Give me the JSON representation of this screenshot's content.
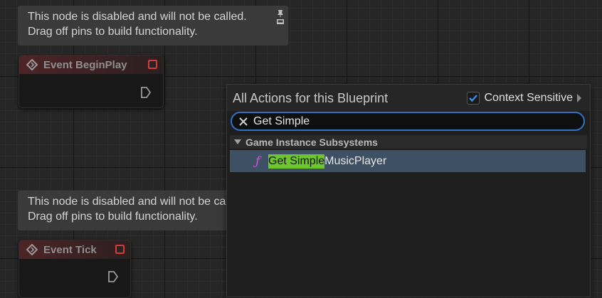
{
  "comments": {
    "top": {
      "line1": "This node is disabled and will not be called.",
      "line2": "Drag off pins to build functionality."
    },
    "bottom": {
      "line1": "This node is disabled and will not be called.",
      "line2": "Drag off pins to build functionality."
    }
  },
  "nodes": {
    "begin_play": {
      "title": "Event BeginPlay"
    },
    "tick": {
      "title": "Event Tick"
    }
  },
  "action_menu": {
    "title": "All Actions for this Blueprint",
    "context_sensitive": {
      "label": "Context Sensitive",
      "checked": true
    },
    "search": {
      "value": "Get Simple",
      "placeholder": ""
    },
    "category": "Game Instance Subsystems",
    "results": [
      {
        "icon": "function-icon",
        "match": "Get Simple",
        "rest": "MusicPlayer"
      }
    ]
  },
  "colors": {
    "accent": "#2f74c9",
    "highlight": "#6ec62f",
    "selection": "#3d5064",
    "function_icon": "#e04ed8",
    "disabled_stop": "#d63b3b"
  }
}
